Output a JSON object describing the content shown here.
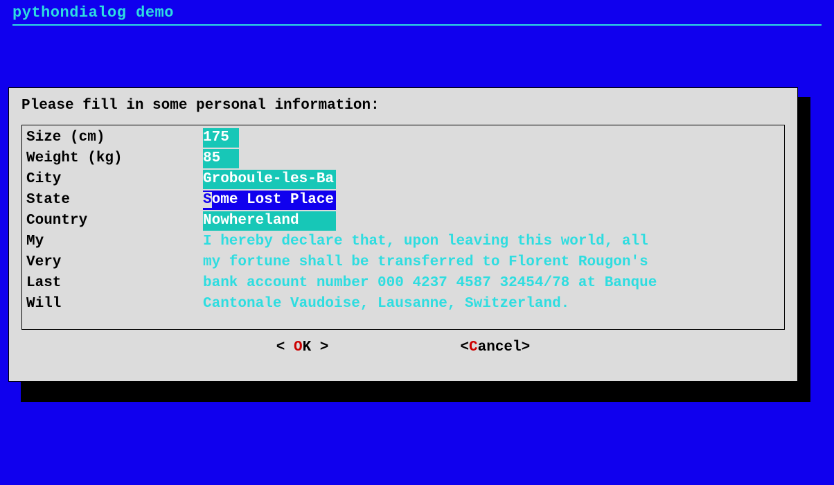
{
  "header": {
    "title": "pythondialog demo"
  },
  "dialog": {
    "prompt": "Please fill in some personal information:",
    "fields": [
      {
        "label": "Size (cm)",
        "value": "175",
        "width_ch": 4
      },
      {
        "label": "Weight (kg)",
        "value": "85",
        "width_ch": 4
      },
      {
        "label": "City",
        "value": "Groboule-les-Ba",
        "width_ch": 15
      },
      {
        "label": "State",
        "value": "Some Lost Place",
        "width_ch": 15,
        "selected": true
      },
      {
        "label": "Country",
        "value": "Nowhereland",
        "width_ch": 15
      }
    ],
    "multiline_labels": [
      "My",
      "Very",
      "Last",
      "Will"
    ],
    "multiline_lines": [
      "I hereby declare that, upon leaving this world, all",
      "my fortune shall be transferred to Florent Rougon's",
      "bank account number 000 4237 4587 32454/78 at Banque",
      "Cantonale Vaudoise, Lausanne, Switzerland."
    ],
    "buttons": {
      "ok": {
        "open": "<  ",
        "hotkey": "O",
        "rest": "K",
        "close": "  >"
      },
      "cancel": {
        "open": "<",
        "hotkey": "C",
        "rest": "ancel",
        "close": ">"
      }
    }
  }
}
